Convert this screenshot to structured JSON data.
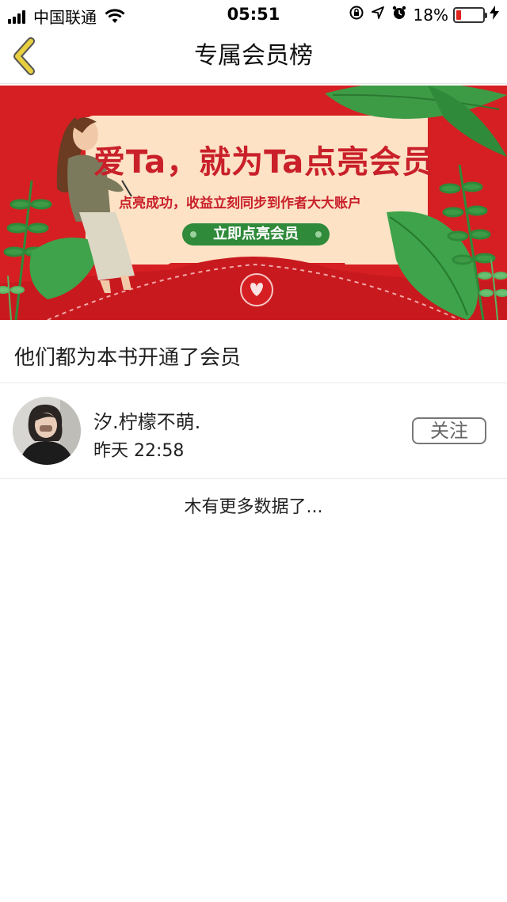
{
  "status_bar": {
    "carrier": "中国联通",
    "time": "05:51",
    "battery_percent": "18%",
    "battery_level": 0.18,
    "icons": [
      "signal-icon",
      "wifi-icon",
      "rotation-lock-icon",
      "location-icon",
      "alarm-icon",
      "battery-icon",
      "charging-icon"
    ]
  },
  "nav": {
    "title": "专属会员榜",
    "back_icon": "chevron-left-icon",
    "accent_color": "#e2c233"
  },
  "banner": {
    "headline": "爱Ta，就为Ta点亮会员",
    "subtitle": "点亮成功，收益立刻同步到作者大大账户",
    "cta_label": "立即点亮会员",
    "background_color": "#d61f22",
    "card_color": "#fde2c5",
    "cta_color": "#2f8a3a"
  },
  "section": {
    "title": "他们都为本书开通了会员"
  },
  "members": [
    {
      "name": "汐.柠檬不萌.",
      "time": "昨天 22:58",
      "follow_label": "关注"
    }
  ],
  "footer": {
    "no_more_text": "木有更多数据了..."
  }
}
